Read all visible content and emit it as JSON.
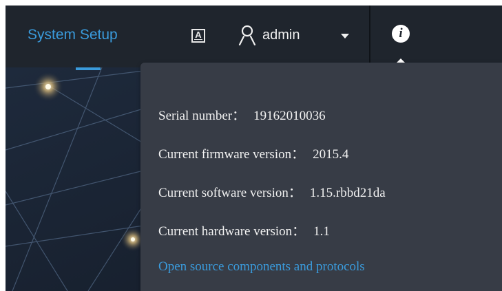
{
  "header": {
    "nav_title": "System Setup",
    "language_icon": "language-icon",
    "language_glyph": "A",
    "user_icon": "user-icon",
    "username": "admin",
    "dropdown_icon": "caret-down-icon",
    "info_icon": "info-icon",
    "info_glyph": "i"
  },
  "info_panel": {
    "serial_label": "Serial number：",
    "serial_value": "19162010036",
    "firmware_label": "Current firmware version：",
    "firmware_value": "2015.4",
    "software_label": "Current software version：",
    "software_value": "1.15.rbbd21da",
    "hardware_label": "Current hardware version：",
    "hardware_value": "1.1",
    "open_source_link": "Open source components and protocols"
  },
  "colors": {
    "accent": "#3a9bdc",
    "topbar": "#1f252d",
    "panel": "#373c46"
  }
}
